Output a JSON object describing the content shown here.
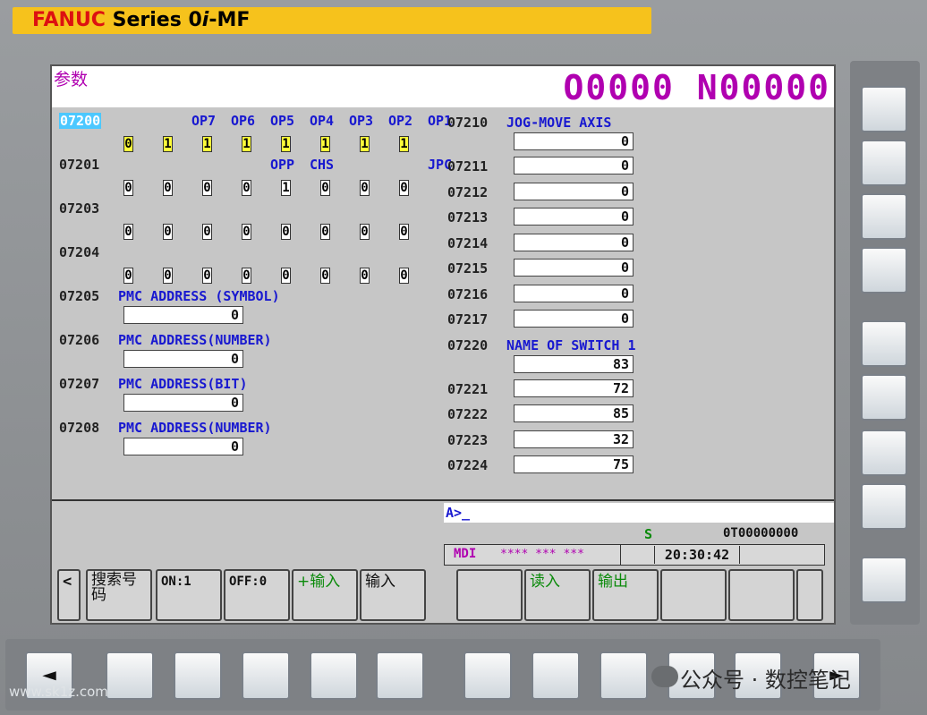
{
  "brand": {
    "maker": "FANUC",
    "series": "Series 0",
    "i": "i",
    "model": "-MF"
  },
  "header": {
    "title": "参数",
    "program": "O0000 N00000"
  },
  "params_left": [
    {
      "num": "07200",
      "selected": true,
      "bit_labels": [
        "",
        "OP7",
        "OP6",
        "OP5",
        "OP4",
        "OP3",
        "OP2",
        "OP1"
      ],
      "bits": [
        "0",
        "1",
        "1",
        "1",
        "1",
        "1",
        "1",
        "1"
      ],
      "highlight": true
    },
    {
      "num": "07201",
      "bit_labels": [
        "",
        "",
        "",
        "OPP",
        "CHS",
        "",
        "",
        "JPC"
      ],
      "bits": [
        "0",
        "0",
        "0",
        "0",
        "1",
        "0",
        "0",
        "0"
      ]
    },
    {
      "num": "07203",
      "bit_labels": [
        "",
        "",
        "",
        "",
        "",
        "",
        "",
        ""
      ],
      "bits": [
        "0",
        "0",
        "0",
        "0",
        "0",
        "0",
        "0",
        "0"
      ]
    },
    {
      "num": "07204",
      "bit_labels": [
        "",
        "",
        "",
        "",
        "",
        "",
        "",
        ""
      ],
      "bits": [
        "0",
        "0",
        "0",
        "0",
        "0",
        "0",
        "0",
        "0"
      ]
    }
  ],
  "params_left_values": [
    {
      "num": "07205",
      "desc": "PMC ADDRESS (SYMBOL)",
      "value": "0"
    },
    {
      "num": "07206",
      "desc": "PMC ADDRESS(NUMBER)",
      "value": "0"
    },
    {
      "num": "07207",
      "desc": "PMC ADDRESS(BIT)",
      "value": "0"
    },
    {
      "num": "07208",
      "desc": "PMC ADDRESS(NUMBER)",
      "value": "0"
    }
  ],
  "params_right": [
    {
      "num": "07210",
      "desc": "JOG-MOVE AXIS",
      "value": "0"
    },
    {
      "num": "07211",
      "desc": "",
      "value": "0"
    },
    {
      "num": "07212",
      "desc": "",
      "value": "0"
    },
    {
      "num": "07213",
      "desc": "",
      "value": "0"
    },
    {
      "num": "07214",
      "desc": "",
      "value": "0"
    },
    {
      "num": "07215",
      "desc": "",
      "value": "0"
    },
    {
      "num": "07216",
      "desc": "",
      "value": "0"
    },
    {
      "num": "07217",
      "desc": "",
      "value": "0"
    },
    {
      "num": "07220",
      "desc": "NAME OF SWITCH 1",
      "value": "83"
    },
    {
      "num": "07221",
      "desc": "",
      "value": "72"
    },
    {
      "num": "07222",
      "desc": "",
      "value": "85"
    },
    {
      "num": "07223",
      "desc": "",
      "value": "32"
    },
    {
      "num": "07224",
      "desc": "",
      "value": "75"
    }
  ],
  "input": {
    "prompt": "A>_"
  },
  "status": {
    "spindle": "S",
    "tool": "0T00000000",
    "mode": "MDI",
    "stars": "**** *** ***",
    "time": "20:30:42"
  },
  "softkeys": {
    "left_arrow": "<",
    "search": "搜索号码",
    "on": "ON:1",
    "off": "OFF:0",
    "plus_input": "+输入",
    "input": "输入",
    "read": "读入",
    "output": "输出"
  },
  "bottom": {
    "left_arrow": "◄",
    "right_arrow": "►"
  },
  "watermark": {
    "site": "www.sk1z.com",
    "account": "公众号 · 数控笔记"
  }
}
